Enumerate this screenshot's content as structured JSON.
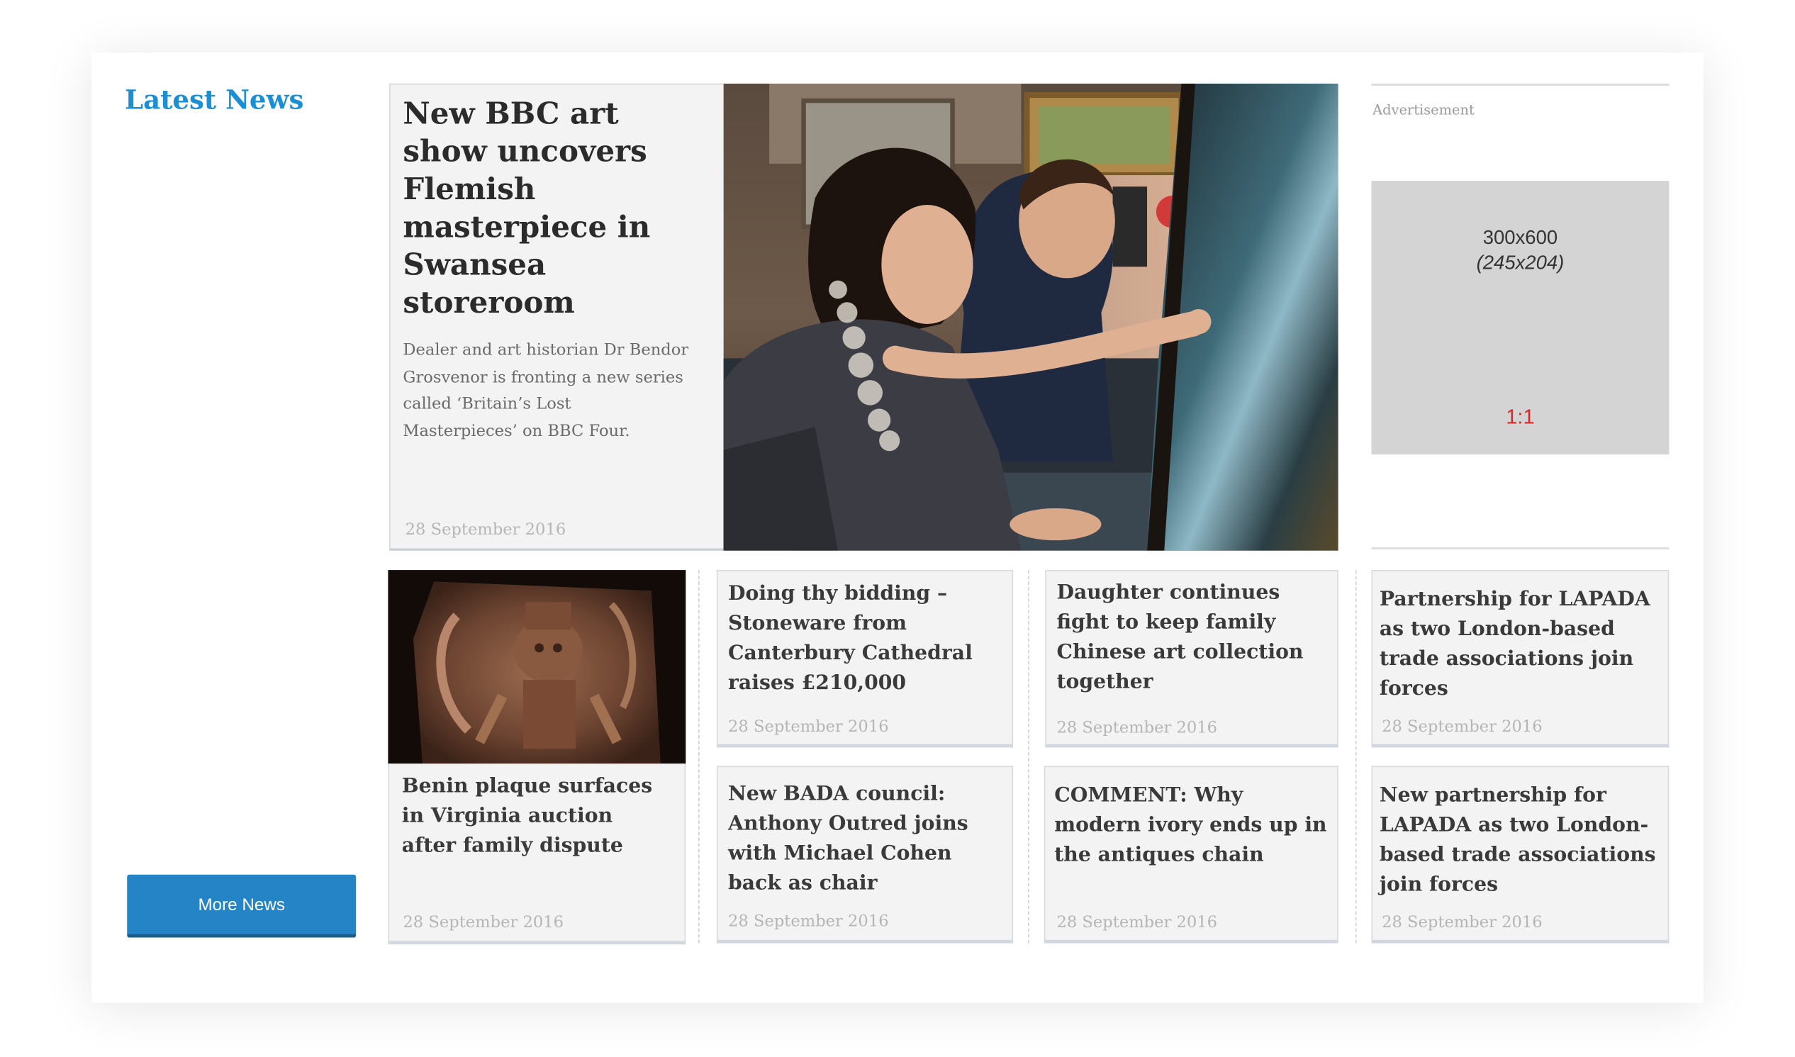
{
  "section": {
    "title": "Latest News",
    "more_button": "More News"
  },
  "hero": {
    "title": "New BBC art show uncovers Flemish masterpiece in Swansea storeroom",
    "summary": "Dealer and art historian Dr Bendor Grosvenor is fronting a new series called ‘Britain’s Lost Masterpieces’ on BBC Four.",
    "date": "28 September 2016"
  },
  "advert": {
    "label": "Advertisement",
    "size": "300x600",
    "subsize": "(245x204)",
    "ratio": "1:1"
  },
  "articles": [
    {
      "title": "Benin plaque surfaces in Virginia auction after family dispute",
      "date": "28 September 2016"
    },
    {
      "title": "Doing thy bidding – Stoneware from Canterbury Cathedral raises £210,000",
      "date": "28 September 2016"
    },
    {
      "title": "Daughter continues fight to keep family Chinese art collection together",
      "date": "28 September 2016"
    },
    {
      "title": "Partnership for LAPADA as two London-based trade associations join forces",
      "date": "28 September 2016"
    },
    {
      "title": "New BADA council: Anthony Outred joins with Michael Cohen back as chair",
      "date": "28 September 2016"
    },
    {
      "title": "COMMENT: Why modern ivory ends up in the antiques chain",
      "date": "28 September 2016"
    },
    {
      "title": "New partnership for LAPADA as two London-based trade associations join forces",
      "date": "28 September 2016"
    }
  ],
  "colors": {
    "accent": "#1a8fd3",
    "button": "#2484c6",
    "card_bg": "#f3f3f3",
    "ad_ratio": "#d72828"
  }
}
